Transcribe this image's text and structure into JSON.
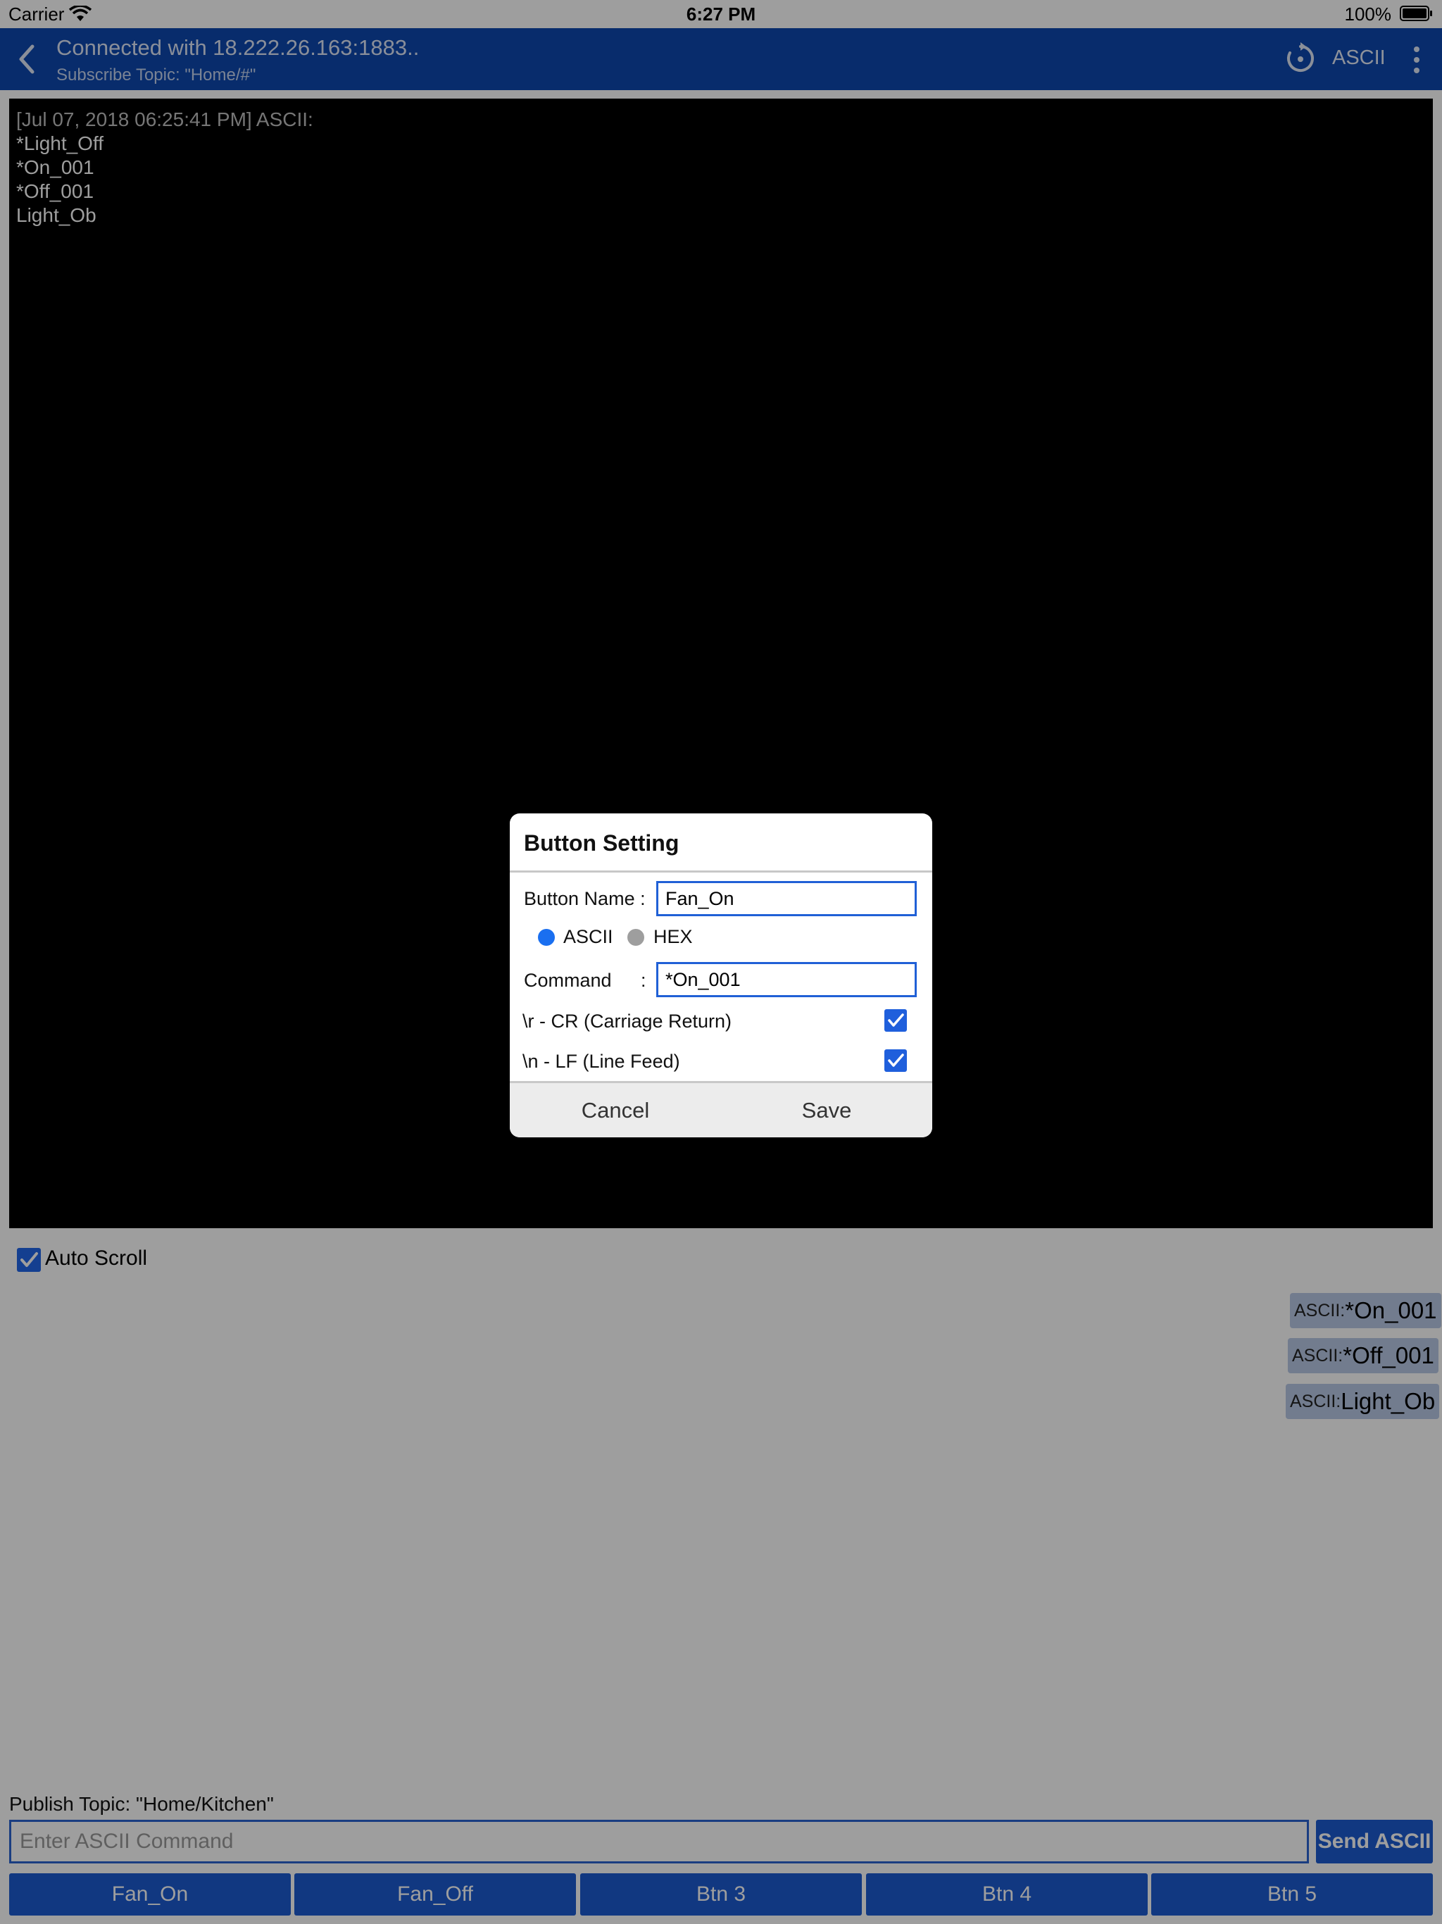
{
  "status_bar": {
    "carrier": "Carrier",
    "time": "6:27 PM",
    "battery": "100%"
  },
  "header": {
    "title": "Connected with 18.222.26.163:1883..",
    "subtitle": "Subscribe Topic: \"Home/#\"",
    "mode": "ASCII",
    "icons": [
      "back-icon",
      "refresh-icon",
      "more-icon"
    ]
  },
  "terminal": {
    "timestamp": "[Jul 07, 2018 06:25:41 PM] ASCII:",
    "lines": [
      "*Light_Off",
      "*On_001",
      "*Off_001",
      "Light_Ob"
    ]
  },
  "auto_scroll": {
    "label": "Auto Scroll",
    "checked": true
  },
  "recent_commands": [
    {
      "prefix": "ASCII:",
      "command": "*On_001"
    },
    {
      "prefix": "ASCII:",
      "command": "*Off_001"
    },
    {
      "prefix": "ASCII:",
      "command": "Light_Ob"
    }
  ],
  "publish": {
    "label": "Publish Topic: \"Home/Kitchen\"",
    "placeholder": "Enter ASCII Command",
    "value": "",
    "send_label": "Send ASCII"
  },
  "quick_buttons": [
    "Fan_On",
    "Fan_Off",
    "Btn 3",
    "Btn 4",
    "Btn 5"
  ],
  "dialog": {
    "title": "Button Setting",
    "name_label": "Button Name :",
    "name_value": "Fan_On",
    "format_options": [
      {
        "label": "ASCII",
        "selected": true
      },
      {
        "label": "HEX",
        "selected": false
      }
    ],
    "command_label": "Command",
    "command_colon": ":",
    "command_value": "*On_001",
    "cr_label": "\\r - CR (Carriage Return)",
    "cr_checked": true,
    "lf_label": "\\n - LF (Line Feed)",
    "lf_checked": true,
    "cancel_label": "Cancel",
    "save_label": "Save"
  },
  "colors": {
    "header": "#0d47ae",
    "accent": "#1c5bd1",
    "radio_selected": "#1a6ff0",
    "radio_unselected": "#9e9e9e"
  }
}
